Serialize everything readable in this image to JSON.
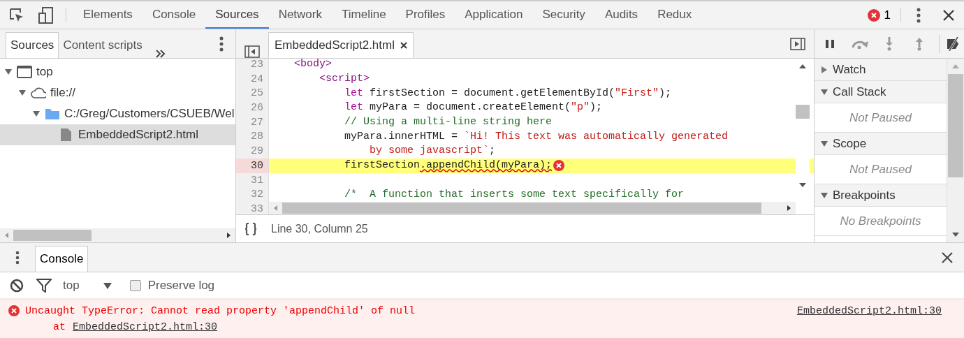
{
  "main_tabs": [
    {
      "label": "Elements",
      "selected": false
    },
    {
      "label": "Console",
      "selected": false
    },
    {
      "label": "Sources",
      "selected": true
    },
    {
      "label": "Network",
      "selected": false
    },
    {
      "label": "Timeline",
      "selected": false
    },
    {
      "label": "Profiles",
      "selected": false
    },
    {
      "label": "Application",
      "selected": false
    },
    {
      "label": "Security",
      "selected": false
    },
    {
      "label": "Audits",
      "selected": false
    },
    {
      "label": "Redux",
      "selected": false
    }
  ],
  "error_count": "1",
  "navigator": {
    "tabs": [
      {
        "label": "Sources",
        "selected": true
      },
      {
        "label": "Content scripts",
        "selected": false
      }
    ],
    "tree": [
      {
        "kind": "frame",
        "label": "top",
        "expanded": true,
        "selected": false,
        "children": [
          {
            "kind": "domain",
            "label": "file://",
            "expanded": true,
            "selected": false,
            "children": [
              {
                "kind": "folder",
                "label": "C:/Greg/Customers/CSUEB/Wel",
                "expanded": true,
                "selected": false,
                "children": [
                  {
                    "kind": "file",
                    "label": "EmbeddedScript2.html",
                    "selected": true
                  }
                ]
              }
            ]
          }
        ]
      }
    ]
  },
  "editor": {
    "tab": "EmbeddedScript2.html",
    "lines": [
      {
        "number": "23",
        "highlighted": false,
        "error": false,
        "tokens": [
          {
            "kind": "tag",
            "text": "    <body>"
          }
        ]
      },
      {
        "number": "24",
        "highlighted": false,
        "error": false,
        "tokens": [
          {
            "kind": "tag",
            "text": "        <script>"
          }
        ]
      },
      {
        "number": "25",
        "highlighted": false,
        "error": false,
        "tokens": [
          {
            "kind": "keyword",
            "text": "            let"
          },
          {
            "kind": "plain",
            "text": " firstSection = document.getElementById("
          },
          {
            "kind": "string",
            "text": "\"First\""
          },
          {
            "kind": "plain",
            "text": ");"
          }
        ]
      },
      {
        "number": "26",
        "highlighted": false,
        "error": false,
        "tokens": [
          {
            "kind": "keyword",
            "text": "            let"
          },
          {
            "kind": "plain",
            "text": " myPara = document.createElement("
          },
          {
            "kind": "string",
            "text": "\"p\""
          },
          {
            "kind": "plain",
            "text": ");"
          }
        ]
      },
      {
        "number": "27",
        "highlighted": false,
        "error": false,
        "tokens": [
          {
            "kind": "comment",
            "text": "            // Using a multi-line string here"
          }
        ]
      },
      {
        "number": "28",
        "highlighted": false,
        "error": false,
        "tokens": [
          {
            "kind": "plain",
            "text": "            myPara.innerHTML = "
          },
          {
            "kind": "string",
            "text": "`Hi! This text was automatically generated"
          }
        ]
      },
      {
        "number": "29",
        "highlighted": false,
        "error": false,
        "tokens": [
          {
            "kind": "string",
            "text": "                by some javascript`"
          },
          {
            "kind": "plain",
            "text": ";"
          }
        ]
      },
      {
        "number": "30",
        "highlighted": true,
        "error": true,
        "tokens": [
          {
            "kind": "plain",
            "text": "            firstSection"
          },
          {
            "kind": "squiggle",
            "text": ".appendChild(myPara);"
          }
        ]
      },
      {
        "number": "31",
        "highlighted": false,
        "error": false
      },
      {
        "number": "32",
        "highlighted": false,
        "error": false,
        "tokens": [
          {
            "kind": "comment",
            "text": "            /*  A function that inserts some text specifically for"
          }
        ]
      },
      {
        "number": "33",
        "highlighted": false,
        "error": false
      }
    ],
    "status": "Line 30, Column 25"
  },
  "debugger": {
    "sections": [
      {
        "title": "Watch",
        "expanded": false
      },
      {
        "title": "Call Stack",
        "expanded": true,
        "content": "Not Paused"
      },
      {
        "title": "Scope",
        "expanded": true,
        "content": "Not Paused"
      },
      {
        "title": "Breakpoints",
        "expanded": true,
        "content": "No Breakpoints"
      }
    ]
  },
  "drawer": {
    "tab": "Console",
    "context": "top",
    "preserve_log": {
      "label": "Preserve log",
      "checked": false
    },
    "messages": [
      {
        "kind": "error",
        "text": "Uncaught TypeError: Cannot read property 'appendChild' of null",
        "at": "at",
        "link": "EmbeddedScript2.html:30",
        "source": "EmbeddedScript2.html:30"
      }
    ]
  }
}
